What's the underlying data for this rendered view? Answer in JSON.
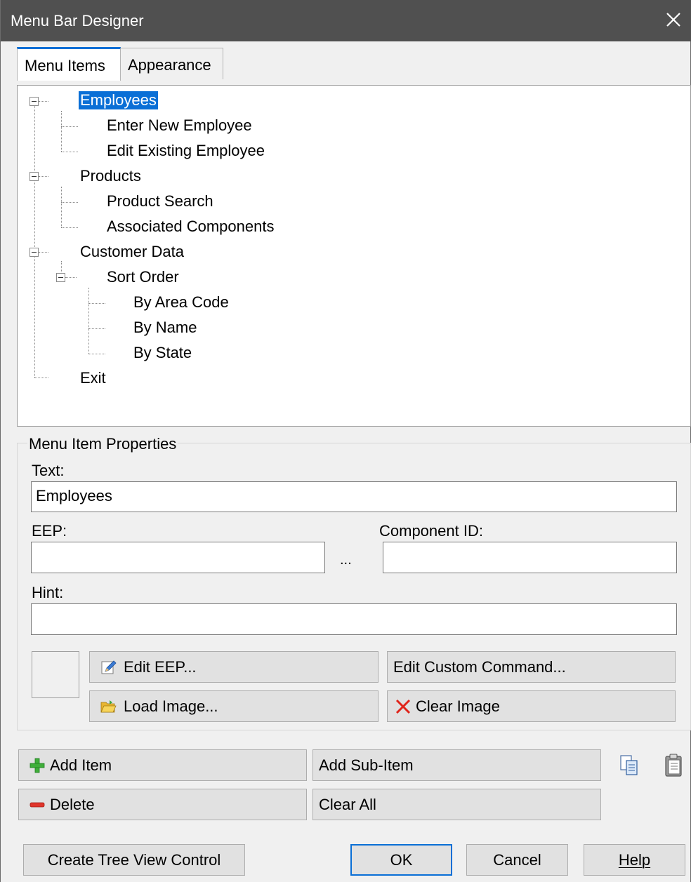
{
  "window": {
    "title": "Menu Bar Designer"
  },
  "tabs": [
    {
      "label": "Menu Items",
      "active": true
    },
    {
      "label": "Appearance",
      "active": false
    }
  ],
  "tree": {
    "items": [
      {
        "label": "Employees",
        "level": 0,
        "selected": true
      },
      {
        "label": "Enter New Employee",
        "level": 1
      },
      {
        "label": "Edit Existing Employee",
        "level": 1
      },
      {
        "label": "Products",
        "level": 0
      },
      {
        "label": "Product Search",
        "level": 1
      },
      {
        "label": "Associated Components",
        "level": 1
      },
      {
        "label": "Customer Data",
        "level": 0
      },
      {
        "label": "Sort Order",
        "level": 1
      },
      {
        "label": "By Area Code",
        "level": 2
      },
      {
        "label": "By Name",
        "level": 2
      },
      {
        "label": "By State",
        "level": 2
      },
      {
        "label": "Exit",
        "level": 0
      }
    ]
  },
  "properties": {
    "group_label": "Menu Item Properties",
    "text_label": "Text:",
    "text_value": "Employees",
    "eep_label": "EEP:",
    "eep_value": "",
    "ellipsis": "...",
    "component_id_label": "Component ID:",
    "component_id_value": "",
    "hint_label": "Hint:",
    "hint_value": "",
    "edit_eep": "Edit EEP...",
    "edit_custom_command": "Edit Custom Command...",
    "load_image": "Load Image...",
    "clear_image": "Clear Image"
  },
  "actions": {
    "add_item": "Add Item",
    "add_sub_item": "Add Sub-Item",
    "delete": "Delete",
    "clear_all": "Clear All"
  },
  "footer": {
    "create_tree_view": "Create Tree View Control",
    "ok": "OK",
    "cancel": "Cancel",
    "help": "Help"
  },
  "icons": {
    "close": "close-icon",
    "edit_eep": "pencil-icon",
    "load_image": "folder-open-icon",
    "clear_image": "red-x-icon",
    "add_item": "green-plus-icon",
    "delete": "red-minus-icon",
    "copy": "copy-icon",
    "paste": "paste-icon"
  },
  "colors": {
    "accent": "#0a6fd6",
    "titlebar": "#505050"
  }
}
